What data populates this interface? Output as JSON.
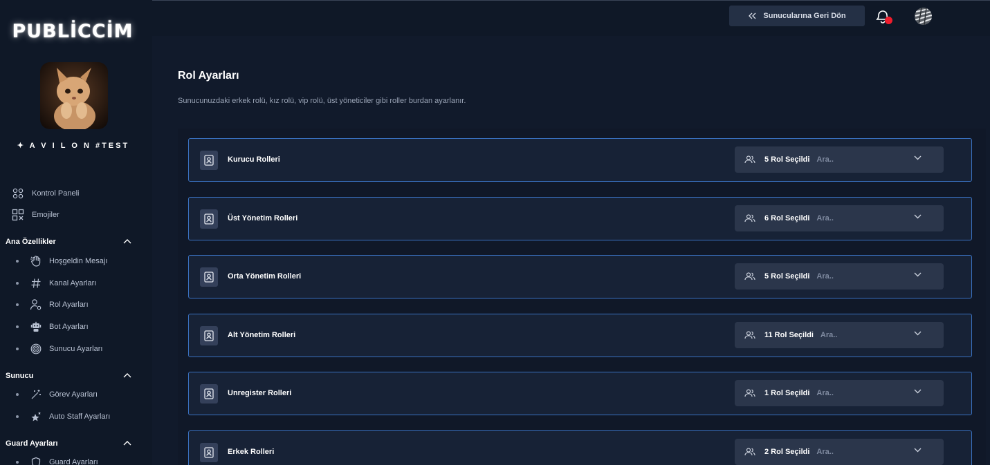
{
  "brand": {
    "name": "PUBLİCCİM"
  },
  "server": {
    "name": "✦ A V I L O N #TEST"
  },
  "nav": {
    "dashboard": "Kontrol Paneli",
    "emojis": "Emojiler"
  },
  "sections": [
    {
      "title": "Ana Özellikler",
      "items": [
        "Hoşgeldin Mesajı",
        "Kanal Ayarları",
        "Rol Ayarları",
        "Bot Ayarları",
        "Sunucu Ayarları"
      ]
    },
    {
      "title": "Sunucu",
      "items": [
        "Görev Ayarları",
        "Auto Staff Ayarları"
      ]
    },
    {
      "title": "Guard Ayarları",
      "items": [
        "Guard Ayarları"
      ]
    }
  ],
  "topbar": {
    "back_label": "Sunucularına Geri Dön"
  },
  "page": {
    "title": "Rol Ayarları",
    "description": "Sunucunuzdaki erkek rolü, kız rolü, vip rolü, üst yöneticiler gibi roller burdan ayarlanır."
  },
  "role_groups": [
    {
      "title": "Kurucu Rolleri",
      "selected": "5 Rol Seçildi",
      "search_placeholder": "Ara.."
    },
    {
      "title": "Üst Yönetim Rolleri",
      "selected": "6 Rol Seçildi",
      "search_placeholder": "Ara.."
    },
    {
      "title": "Orta Yönetim Rolleri",
      "selected": "5 Rol Seçildi",
      "search_placeholder": "Ara.."
    },
    {
      "title": "Alt Yönetim Rolleri",
      "selected": "11 Rol Seçildi",
      "search_placeholder": "Ara.."
    },
    {
      "title": "Unregister Rolleri",
      "selected": "1 Rol Seçildi",
      "search_placeholder": "Ara.."
    },
    {
      "title": "Erkek Rolleri",
      "selected": "2 Rol Seçildi",
      "search_placeholder": "Ara.."
    }
  ],
  "colors": {
    "accent_border": "#3a72c2",
    "notification": "#f01c2c",
    "background": "#111a2b"
  }
}
